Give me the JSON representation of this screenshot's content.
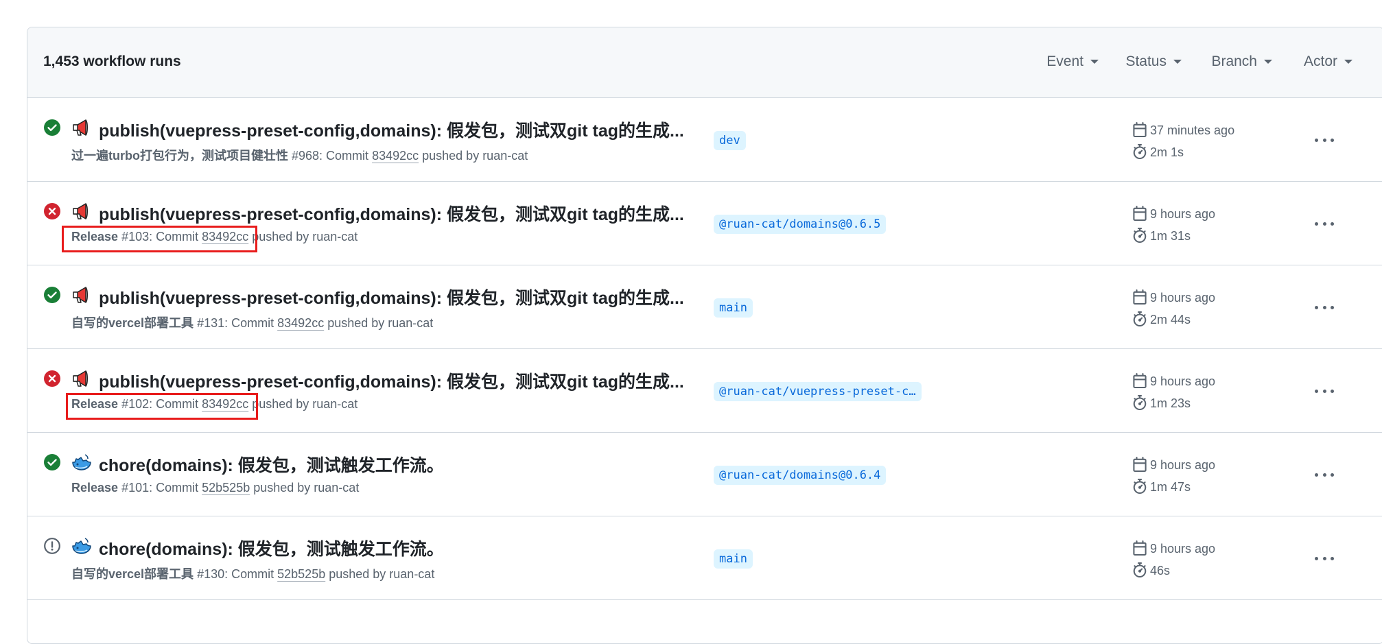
{
  "header": {
    "run_count": "1,453 workflow runs",
    "filters": [
      "Event",
      "Status",
      "Branch",
      "Actor"
    ]
  },
  "runs": [
    {
      "status": "success",
      "icon": "megaphone-icon",
      "title": "publish(vuepress-preset-config,domains): 假发包，测试双git tag的生成...",
      "workflow": "过一遍turbo打包行为，测试项目健壮性",
      "run_number": "#968",
      "commit_prefix": ": Commit ",
      "sha": "83492cc",
      "pushed_by": " pushed by ruan-cat",
      "branch": "dev",
      "date": "37 minutes ago",
      "duration": "2m 1s"
    },
    {
      "status": "failure",
      "icon": "megaphone-icon",
      "title": "publish(vuepress-preset-config,domains): 假发包，测试双git tag的生成...",
      "workflow": "Release",
      "run_number": "#103",
      "commit_prefix": ": Commit ",
      "sha": "83492cc",
      "pushed_by": " pushed by ruan-cat",
      "branch": "@ruan-cat/domains@0.6.5",
      "date": "9 hours ago",
      "duration": "1m 31s"
    },
    {
      "status": "success",
      "icon": "megaphone-icon",
      "title": "publish(vuepress-preset-config,domains): 假发包，测试双git tag的生成...",
      "workflow": "自写的vercel部署工具",
      "run_number": "#131",
      "commit_prefix": ": Commit ",
      "sha": "83492cc",
      "pushed_by": " pushed by ruan-cat",
      "branch": "main",
      "date": "9 hours ago",
      "duration": "2m 44s"
    },
    {
      "status": "failure",
      "icon": "megaphone-icon",
      "title": "publish(vuepress-preset-config,domains): 假发包，测试双git tag的生成...",
      "workflow": "Release",
      "run_number": "#102",
      "commit_prefix": ": Commit ",
      "sha": "83492cc",
      "pushed_by": " pushed by ruan-cat",
      "branch": "@ruan-cat/vuepress-preset-c…",
      "date": "9 hours ago",
      "duration": "1m 23s"
    },
    {
      "status": "success",
      "icon": "whale-icon",
      "title": "chore(domains): 假发包，测试触发工作流。",
      "workflow": "Release",
      "run_number": "#101",
      "commit_prefix": ": Commit ",
      "sha": "52b525b",
      "pushed_by": " pushed by ruan-cat",
      "branch": "@ruan-cat/domains@0.6.4",
      "date": "9 hours ago",
      "duration": "1m 47s"
    },
    {
      "status": "neutral",
      "icon": "whale-icon",
      "title": "chore(domains): 假发包，测试触发工作流。",
      "workflow": "自写的vercel部署工具",
      "run_number": "#130",
      "commit_prefix": ": Commit ",
      "sha": "52b525b",
      "pushed_by": " pushed by ruan-cat",
      "branch": "main",
      "date": "9 hours ago",
      "duration": "46s"
    }
  ],
  "colors": {
    "success": "#1a7f37",
    "failure": "#d1242f",
    "neutral": "#59636e",
    "highlight": "#e81c1c"
  }
}
